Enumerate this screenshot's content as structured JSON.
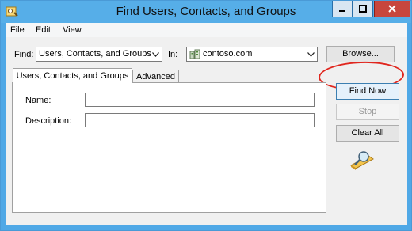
{
  "window": {
    "title": "Find Users, Contacts, and Groups",
    "controls": {
      "minimize_icon": "minimize-icon",
      "maximize_icon": "maximize-icon",
      "close_icon": "close-icon"
    },
    "title_bar_color": "#56aee8",
    "close_color": "#c7463d"
  },
  "menu": {
    "items": [
      "File",
      "Edit",
      "View"
    ]
  },
  "find": {
    "label": "Find:",
    "value": "Users, Contacts, and Groups"
  },
  "in": {
    "label": "In:",
    "value": "contoso.com",
    "icon": "domain-icon"
  },
  "browse_button": {
    "label": "Browse..."
  },
  "tabs": [
    {
      "label": "Users, Contacts, and Groups",
      "active": true
    },
    {
      "label": "Advanced",
      "active": false
    }
  ],
  "form": {
    "name_label": "Name:",
    "name_value": "",
    "description_label": "Description:",
    "description_value": ""
  },
  "actions": {
    "find_now": "Find Now",
    "stop": "Stop",
    "clear_all": "Clear All"
  },
  "annotation_color": "#e0261e",
  "search_icon": "magnifier-icon"
}
